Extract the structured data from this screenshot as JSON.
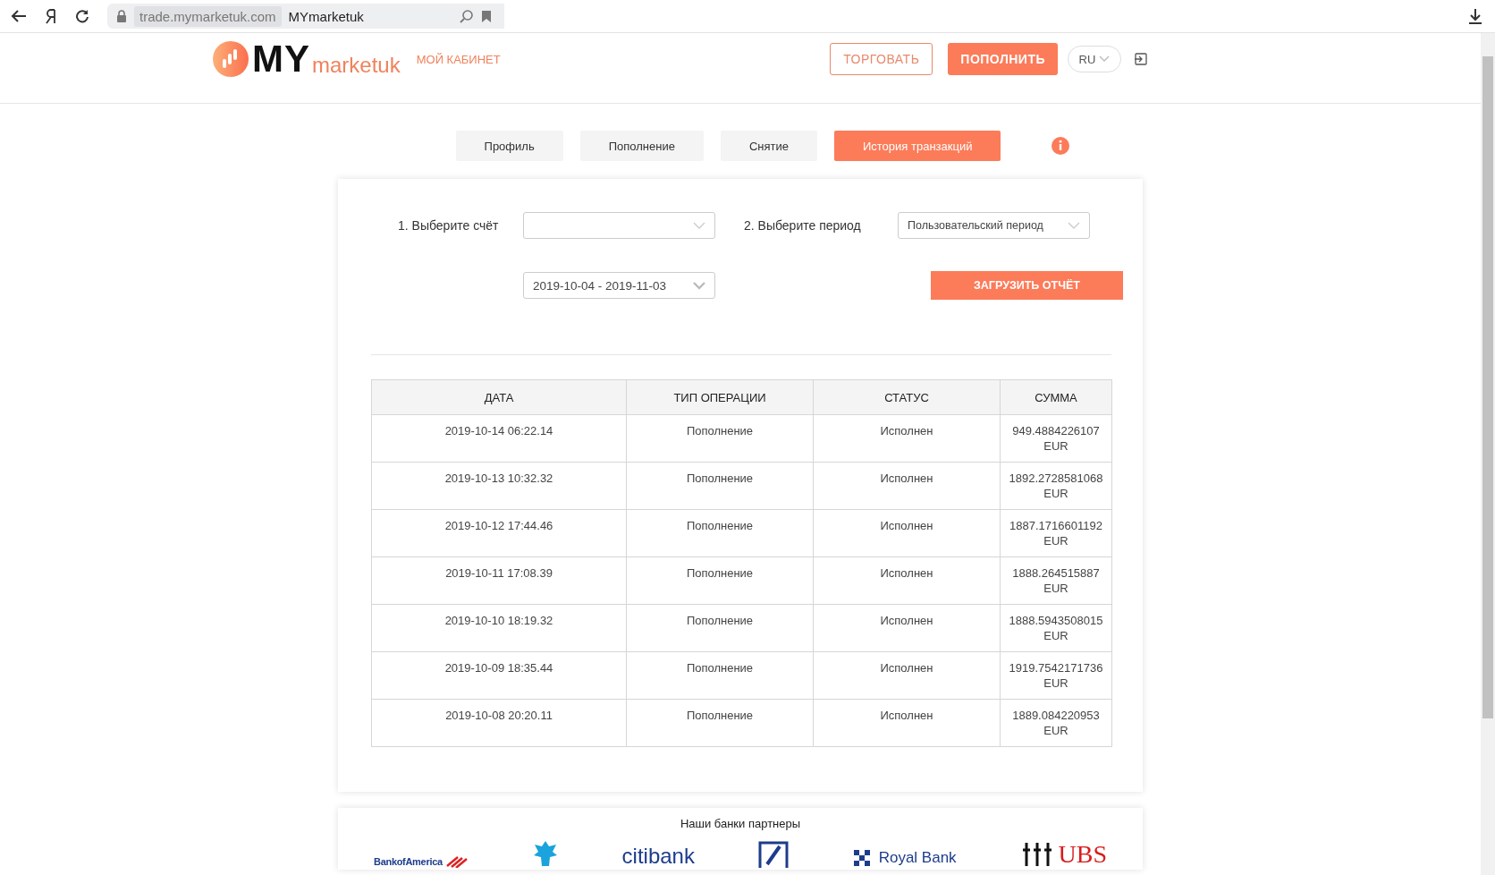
{
  "browser": {
    "url": "trade.mymarketuk.com",
    "title": "MYmarketuk"
  },
  "header": {
    "logo_mark": "MY",
    "logo_name": "marketuk",
    "cabinet_link": "МОЙ КАБИНЕТ",
    "trade_button": "ТОРГОВАТЬ",
    "deposit_button": "ПОПОЛНИТЬ",
    "language": "RU"
  },
  "tabs": [
    {
      "label": "Профиль",
      "selected": false
    },
    {
      "label": "Пополнение",
      "selected": false
    },
    {
      "label": "Снятие",
      "selected": false
    },
    {
      "label": "История транзакций",
      "selected": true
    }
  ],
  "filters": {
    "account_label": "1. Выберите счёт",
    "period_label": "2. Выберите период",
    "period_value": "Пользовательский период",
    "date_range": "2019-10-04 - 2019-11-03",
    "load_button": "ЗАГРУЗИТЬ ОТЧЁТ"
  },
  "table": {
    "columns": [
      "ДАТА",
      "ТИП ОПЕРАЦИИ",
      "СТАТУС",
      "СУММА"
    ],
    "rows": [
      {
        "date": "2019-10-14 06:22.14",
        "type": "Пополнение",
        "status": "Исполнен",
        "amount": "949.4884226107 EUR"
      },
      {
        "date": "2019-10-13 10:32.32",
        "type": "Пополнение",
        "status": "Исполнен",
        "amount": "1892.2728581068 EUR"
      },
      {
        "date": "2019-10-12 17:44.46",
        "type": "Пополнение",
        "status": "Исполнен",
        "amount": "1887.1716601192 EUR"
      },
      {
        "date": "2019-10-11 17:08.39",
        "type": "Пополнение",
        "status": "Исполнен",
        "amount": "1888.264515887 EUR"
      },
      {
        "date": "2019-10-10 18:19.32",
        "type": "Пополнение",
        "status": "Исполнен",
        "amount": "1888.5943508015 EUR"
      },
      {
        "date": "2019-10-09 18:35.44",
        "type": "Пополнение",
        "status": "Исполнен",
        "amount": "1919.7542171736 EUR"
      },
      {
        "date": "2019-10-08 20:20.11",
        "type": "Пополнение",
        "status": "Исполнен",
        "amount": "1889.084220953 EUR"
      }
    ]
  },
  "partners": {
    "title": "Наши банки партнеры",
    "banks": [
      {
        "kind": "boa",
        "text": "BankofAmerica"
      },
      {
        "kind": "eagle"
      },
      {
        "kind": "citi",
        "text": "citibank"
      },
      {
        "kind": "square"
      },
      {
        "kind": "rbs",
        "text": "Royal Bank"
      },
      {
        "kind": "ubs",
        "text": "UBS"
      }
    ]
  }
}
